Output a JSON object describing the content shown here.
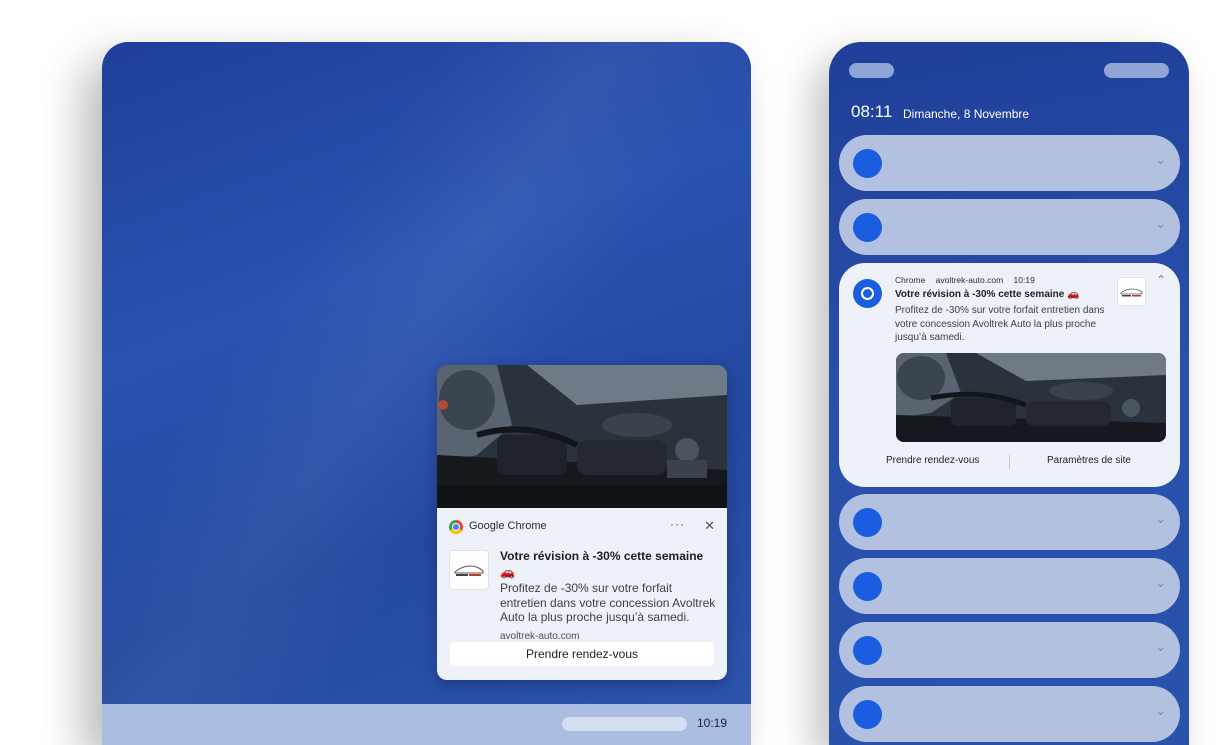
{
  "desktop": {
    "taskbar_time": "10:19",
    "toast": {
      "app_name": "Google Chrome",
      "title": "Votre révision à -30% cette semaine 🚗",
      "body": "Profitez de -30% sur votre forfait entretien dans votre concession Avoltrek Auto la plus proche jusqu’à samedi.",
      "url": "avoltrek-auto.com",
      "action_label": "Prendre rendez-vous",
      "more_glyph": "···",
      "close_glyph": "✕"
    }
  },
  "phone": {
    "clock": "08:11",
    "date": "Dimanche, 8 Novembre",
    "expanded_notification": {
      "app": "Chrome",
      "domain": "avoltrek-auto.com",
      "time": "10:19",
      "title": "Votre révision à -30% cette semaine 🚗",
      "body": "Profitez de -30% sur votre forfait entretien dans votre concession Avoltrek Auto la plus proche jusqu’à samedi.",
      "action_primary": "Prendre rendez-vous",
      "action_secondary": "Paramètres de site"
    },
    "collapsed_chevron": "⌄",
    "expanded_chevron": "⌃"
  },
  "colors": {
    "wallpaper": "#2a50ac",
    "chrome_blue": "#1a5de0",
    "card_collapsed": "#b3c1e1",
    "card_expanded": "#eef1f8"
  }
}
